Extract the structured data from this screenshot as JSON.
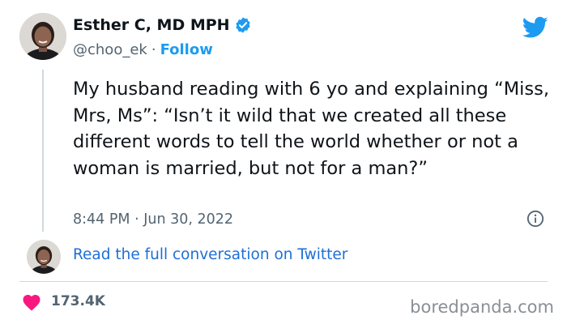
{
  "author": {
    "display_name": "Esther C, MD MPH",
    "handle": "@choo_ek",
    "separator": "·",
    "follow_label": "Follow"
  },
  "tweet": {
    "text": "My husband reading with 6 yo and explaining “Miss, Mrs, Ms”: “Isn’t it wild that we created all these different words to tell the world whether or not a woman is married, but not for a man?”",
    "timestamp": "8:44 PM · Jun 30, 2022"
  },
  "conversation_link": "Read the full conversation on Twitter",
  "likes": {
    "count": "173.4K"
  },
  "watermark": "boredpanda.com",
  "icons": {
    "verified": "verified-badge-icon",
    "brand": "twitter-bird-icon",
    "info": "info-icon",
    "like": "heart-icon"
  },
  "colors": {
    "accent": "#1d9bf0",
    "link": "#1d6fd6",
    "heart": "#f91880",
    "secondary_text": "#536471",
    "primary_text": "#0f1419"
  }
}
